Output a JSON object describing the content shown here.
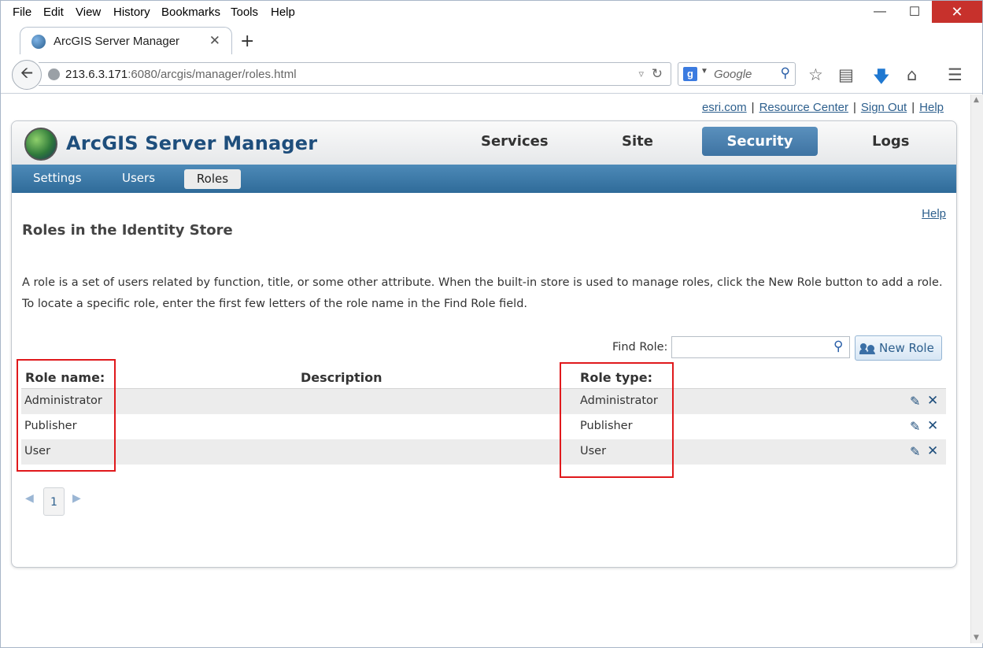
{
  "menu": [
    "File",
    "Edit",
    "View",
    "History",
    "Bookmarks",
    "Tools",
    "Help"
  ],
  "tab": {
    "title": "ArcGIS Server Manager"
  },
  "address": {
    "host": "213.6.3.171",
    "rest": ":6080/arcgis/manager/roles.html"
  },
  "search": {
    "placeholder": "Google"
  },
  "toplinks": [
    "esri.com",
    "Resource Center",
    "Sign Out",
    "Help"
  ],
  "brand": "ArcGIS Server Manager",
  "mainnav": [
    "Services",
    "Site",
    "Security",
    "Logs"
  ],
  "subnav": [
    "Settings",
    "Users",
    "Roles"
  ],
  "help": "Help",
  "title": "Roles in the Identity Store",
  "description": "A role is a set of users related by function, title, or some other attribute. When the built-in store is used to manage roles, click the New Role button to add a role. To locate a specific role, enter the first few letters of the role name in the Find Role field.",
  "find": {
    "label": "Find Role:",
    "value": ""
  },
  "new_role": "New Role",
  "columns": {
    "name": "Role name:",
    "description": "Description",
    "type": "Role type:"
  },
  "rows": [
    {
      "name": "Administrator",
      "description": "",
      "type": "Administrator"
    },
    {
      "name": "Publisher",
      "description": "",
      "type": "Publisher"
    },
    {
      "name": "User",
      "description": "",
      "type": "User"
    }
  ],
  "pagination": {
    "current": "1"
  },
  "colors": {
    "accent": "#3e73a2",
    "highlight": "#e0191c",
    "link": "#2d5f8d"
  }
}
